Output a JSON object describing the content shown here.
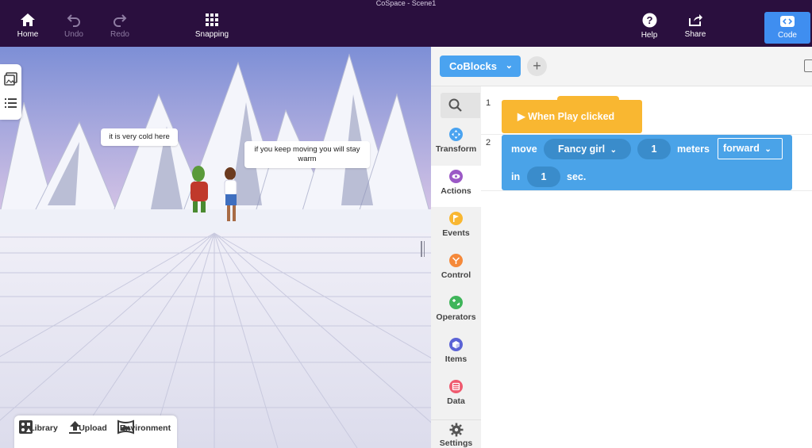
{
  "window": {
    "title": "CoSpace - Scene1"
  },
  "toolbar": {
    "home_label": "Home",
    "undo_label": "Undo",
    "redo_label": "Redo",
    "snapping_label": "Snapping",
    "help_label": "Help",
    "share_label": "Share",
    "code_label": "Code"
  },
  "scene": {
    "speech_left": "it is very cold here",
    "speech_right": "if you keep moving you will stay warm"
  },
  "bottom_toolbar": {
    "library_label": "Library",
    "upload_label": "Upload",
    "environment_label": "Environment"
  },
  "code_panel": {
    "tab_label": "CoBlocks",
    "add_tab_symbol": "+",
    "categories": [
      {
        "label": "Transform",
        "color": "#4aa3f0"
      },
      {
        "label": "Actions",
        "color": "#9b59c6"
      },
      {
        "label": "Events",
        "color": "#f9b731"
      },
      {
        "label": "Control",
        "color": "#f5893a"
      },
      {
        "label": "Operators",
        "color": "#3fb55a"
      },
      {
        "label": "Items",
        "color": "#5b63d6"
      },
      {
        "label": "Data",
        "color": "#ef5a6f"
      },
      {
        "label": "Settings",
        "color": "#555555"
      }
    ],
    "lines": [
      {
        "number": "1"
      },
      {
        "number": "2"
      }
    ],
    "event_block": {
      "label": "▶ When Play clicked"
    },
    "action_block": {
      "move_label": "move",
      "target": "Fancy girl",
      "distance": "1",
      "meters_label": "meters",
      "direction": "forward",
      "in_label": "in",
      "duration": "1",
      "sec_label": "sec."
    }
  },
  "colors": {
    "topbar": "#2a0f3e",
    "accent": "#3f8ef0",
    "block_blue": "#4aa3e8",
    "block_yellow": "#f9b731"
  }
}
